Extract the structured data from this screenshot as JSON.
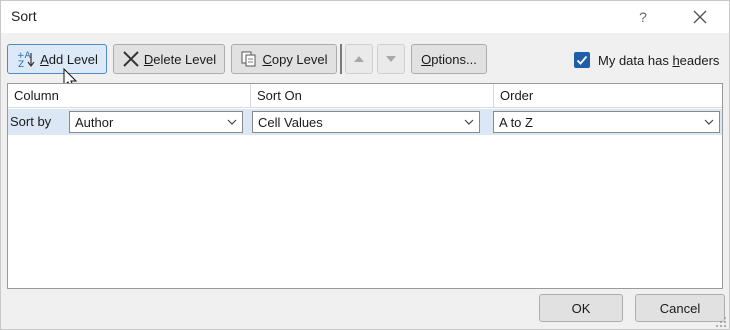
{
  "window": {
    "title": "Sort",
    "help_glyph": "?",
    "close_glyph": "✕"
  },
  "toolbar": {
    "add_level": {
      "mnemonic": "A",
      "rest": "dd Level"
    },
    "delete_level": {
      "mnemonic": "D",
      "rest": "elete Level"
    },
    "copy_level": {
      "mnemonic": "C",
      "rest": "opy Level"
    },
    "options": {
      "mnemonic": "O",
      "rest": "ptions..."
    },
    "headers_checkbox": {
      "checked": true,
      "label_pre": "My data has ",
      "mnemonic": "h",
      "label_post": "eaders"
    }
  },
  "grid": {
    "columns": [
      "Column",
      "Sort On",
      "Order"
    ],
    "rows": [
      {
        "label": "Sort by",
        "column": "Author",
        "sort_on": "Cell Values",
        "order": "A to Z"
      }
    ]
  },
  "footer": {
    "ok": "OK",
    "cancel": "Cancel"
  },
  "colors": {
    "accent": "#1f5fa8",
    "selected_row": "#dbe7f5",
    "active_button": "#dce9f7"
  }
}
